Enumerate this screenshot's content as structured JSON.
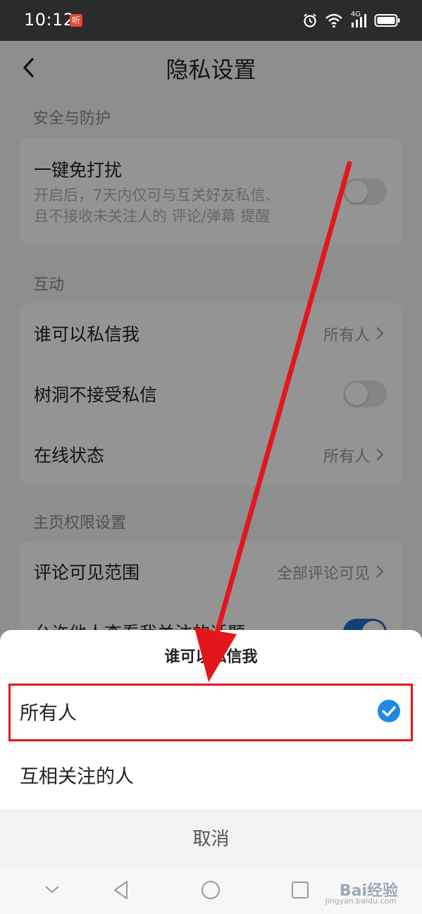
{
  "status_bar": {
    "time": "10:12",
    "listen_badge": "听",
    "network": "4G"
  },
  "header": {
    "title": "隐私设置"
  },
  "sections": {
    "security": {
      "label": "安全与防护",
      "dnd_title": "一键免打扰",
      "dnd_desc_line1": "开启后，7天内仅可与互关好友私信、",
      "dnd_desc_line2": "且不接收未关注人的 评论/弹幕 提醒",
      "dnd_on": false
    },
    "interaction": {
      "label": "互动",
      "who_can_dm_label": "谁可以私信我",
      "who_can_dm_value": "所有人",
      "treehole_label": "树洞不接受私信",
      "treehole_on": false,
      "online_status_label": "在线状态",
      "online_status_value": "所有人"
    },
    "homepage": {
      "label": "主页权限设置",
      "comment_scope_label": "评论可见范围",
      "comment_scope_value": "全部评论可见",
      "allow_view_topics_label": "允许他人查看我关注的话题",
      "allow_view_topics_on": true
    }
  },
  "sheet": {
    "title": "谁可以私信我",
    "options": [
      {
        "label": "所有人",
        "selected": true
      },
      {
        "label": "互相关注的人",
        "selected": false
      }
    ],
    "cancel_label": "取消"
  },
  "watermark": {
    "text": "Bai经验",
    "url": "jingyan.baidu.com"
  },
  "colors": {
    "accent": "#1f6fc9",
    "highlight": "#e3161c",
    "check": "#1e88e5"
  }
}
